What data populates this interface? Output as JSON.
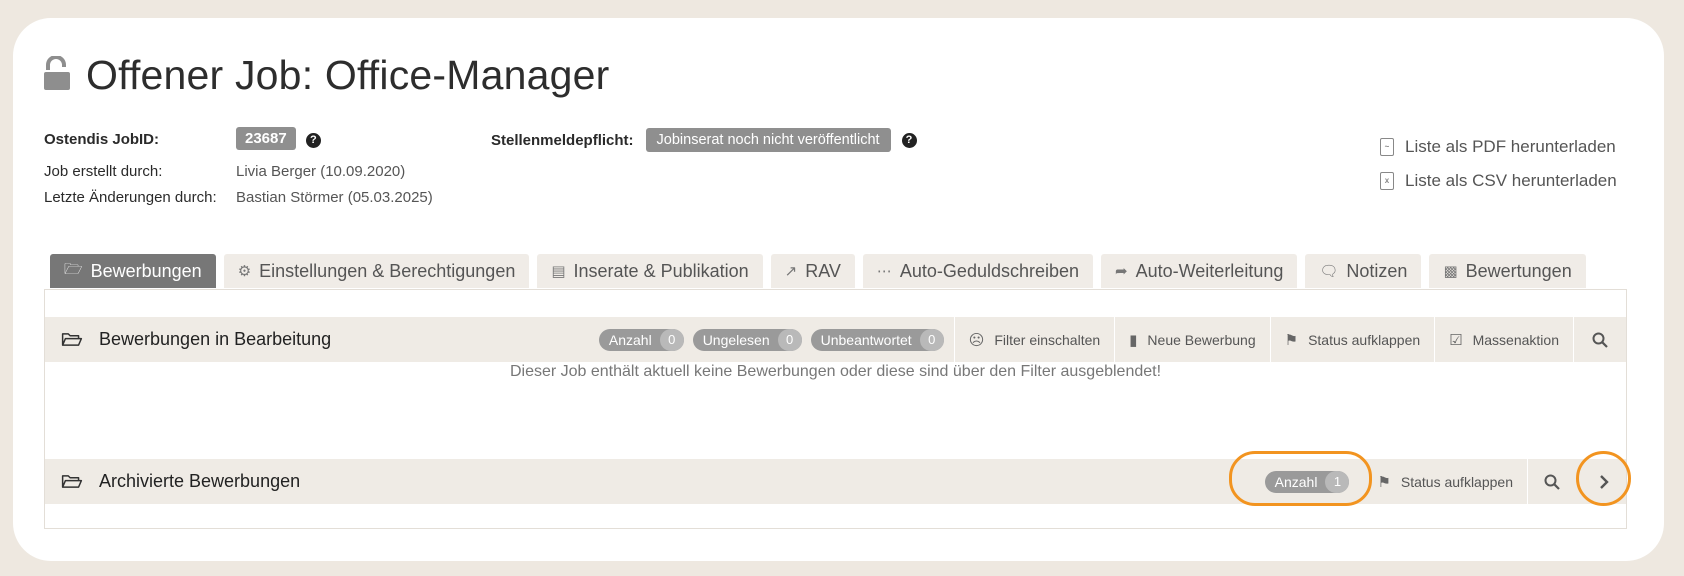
{
  "page": {
    "title": "Offener Job: Office-Manager"
  },
  "meta": {
    "jobid_label": "Ostendis JobID:",
    "jobid_value": "23687",
    "created_label": "Job erstellt durch:",
    "created_value": "Livia Berger (10.09.2020)",
    "changed_label": "Letzte Änderungen durch:",
    "changed_value": "Bastian Störmer (05.03.2025)",
    "stellen_label": "Stellenmeldepflicht:",
    "stellen_value": "Jobinserat noch nicht veröffentlicht"
  },
  "downloads": {
    "pdf": "Liste als PDF herunterladen",
    "csv": "Liste als CSV herunterladen"
  },
  "tabs": [
    {
      "label": "Bewerbungen",
      "icon": "folder-open-icon",
      "active": true
    },
    {
      "label": "Einstellungen & Berechtigungen",
      "icon": "gears-icon"
    },
    {
      "label": "Inserate & Publikation",
      "icon": "newspaper-icon"
    },
    {
      "label": "RAV",
      "icon": "external-link-icon"
    },
    {
      "label": "Auto-Geduldschreiben",
      "icon": "ellipsis-icon"
    },
    {
      "label": "Auto-Weiterleitung",
      "icon": "share-icon"
    },
    {
      "label": "Notizen",
      "icon": "comment-icon"
    },
    {
      "label": "Bewertungen",
      "icon": "bar-chart-icon"
    }
  ],
  "active_section": {
    "title": "Bewerbungen in Bearbeitung",
    "counters": [
      {
        "label": "Anzahl",
        "count": "0"
      },
      {
        "label": "Ungelesen",
        "count": "0"
      },
      {
        "label": "Unbeantwortet",
        "count": "0"
      }
    ],
    "actions": {
      "filter": "Filter einschalten",
      "new": "Neue Bewerbung",
      "status": "Status aufklappen",
      "mass": "Massenaktion"
    },
    "empty_message": "Dieser Job enthält aktuell keine Bewerbungen oder diese sind über den Filter ausgeblendet!"
  },
  "archive_section": {
    "title": "Archivierte Bewerbungen",
    "count_label": "Anzahl",
    "count": "1",
    "status": "Status aufklappen"
  },
  "colors": {
    "highlight": "#f29420",
    "active_tab": "#777777",
    "bar_bg": "#efebe5"
  }
}
